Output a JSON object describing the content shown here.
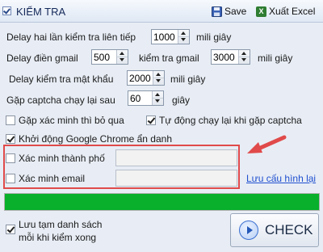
{
  "titlebar": {
    "title": "KIỂM TRA",
    "save": "Save",
    "export": "Xuất Excel"
  },
  "delays": {
    "check_label": "Delay hai lần kiểm tra liên tiếp",
    "check_value": "1000",
    "check_unit": "mili giây",
    "gmail_label": "Delay điền gmail",
    "gmail_value": "500",
    "gmail_check_label": "kiểm tra gmail",
    "gmail_check_value": "3000",
    "gmail_check_unit": "mili giây",
    "password_label": "Delay kiểm tra mật khẩu",
    "password_value": "2000",
    "password_unit": "mili giây",
    "captcha_label": "Gặp captcha chạy lại sau",
    "captcha_value": "60",
    "captcha_unit": "giây"
  },
  "options": {
    "skip_verify": {
      "label": "Gặp xác minh thì bỏ qua",
      "checked": false
    },
    "auto_rerun": {
      "label": "Tự động chạy lại khi gặp captcha",
      "checked": true
    },
    "start_chrome": {
      "label": "Khởi động Google Chrome ẩn danh",
      "checked": true
    },
    "verify_city": {
      "label": "Xác minh thành phố",
      "checked": false,
      "value": ""
    },
    "verify_email": {
      "label": "Xác minh email",
      "checked": false,
      "value": ""
    }
  },
  "save_config_link": "Lưu cấu hình lại",
  "progress": {
    "percent": 100,
    "color": "#08b02b"
  },
  "save_temp": {
    "line1": "Lưu tạm danh sách",
    "line2": "mỗi khi kiểm xong",
    "checked": true
  },
  "check_button": "CHECK",
  "highlight_color": "#e04a4a"
}
